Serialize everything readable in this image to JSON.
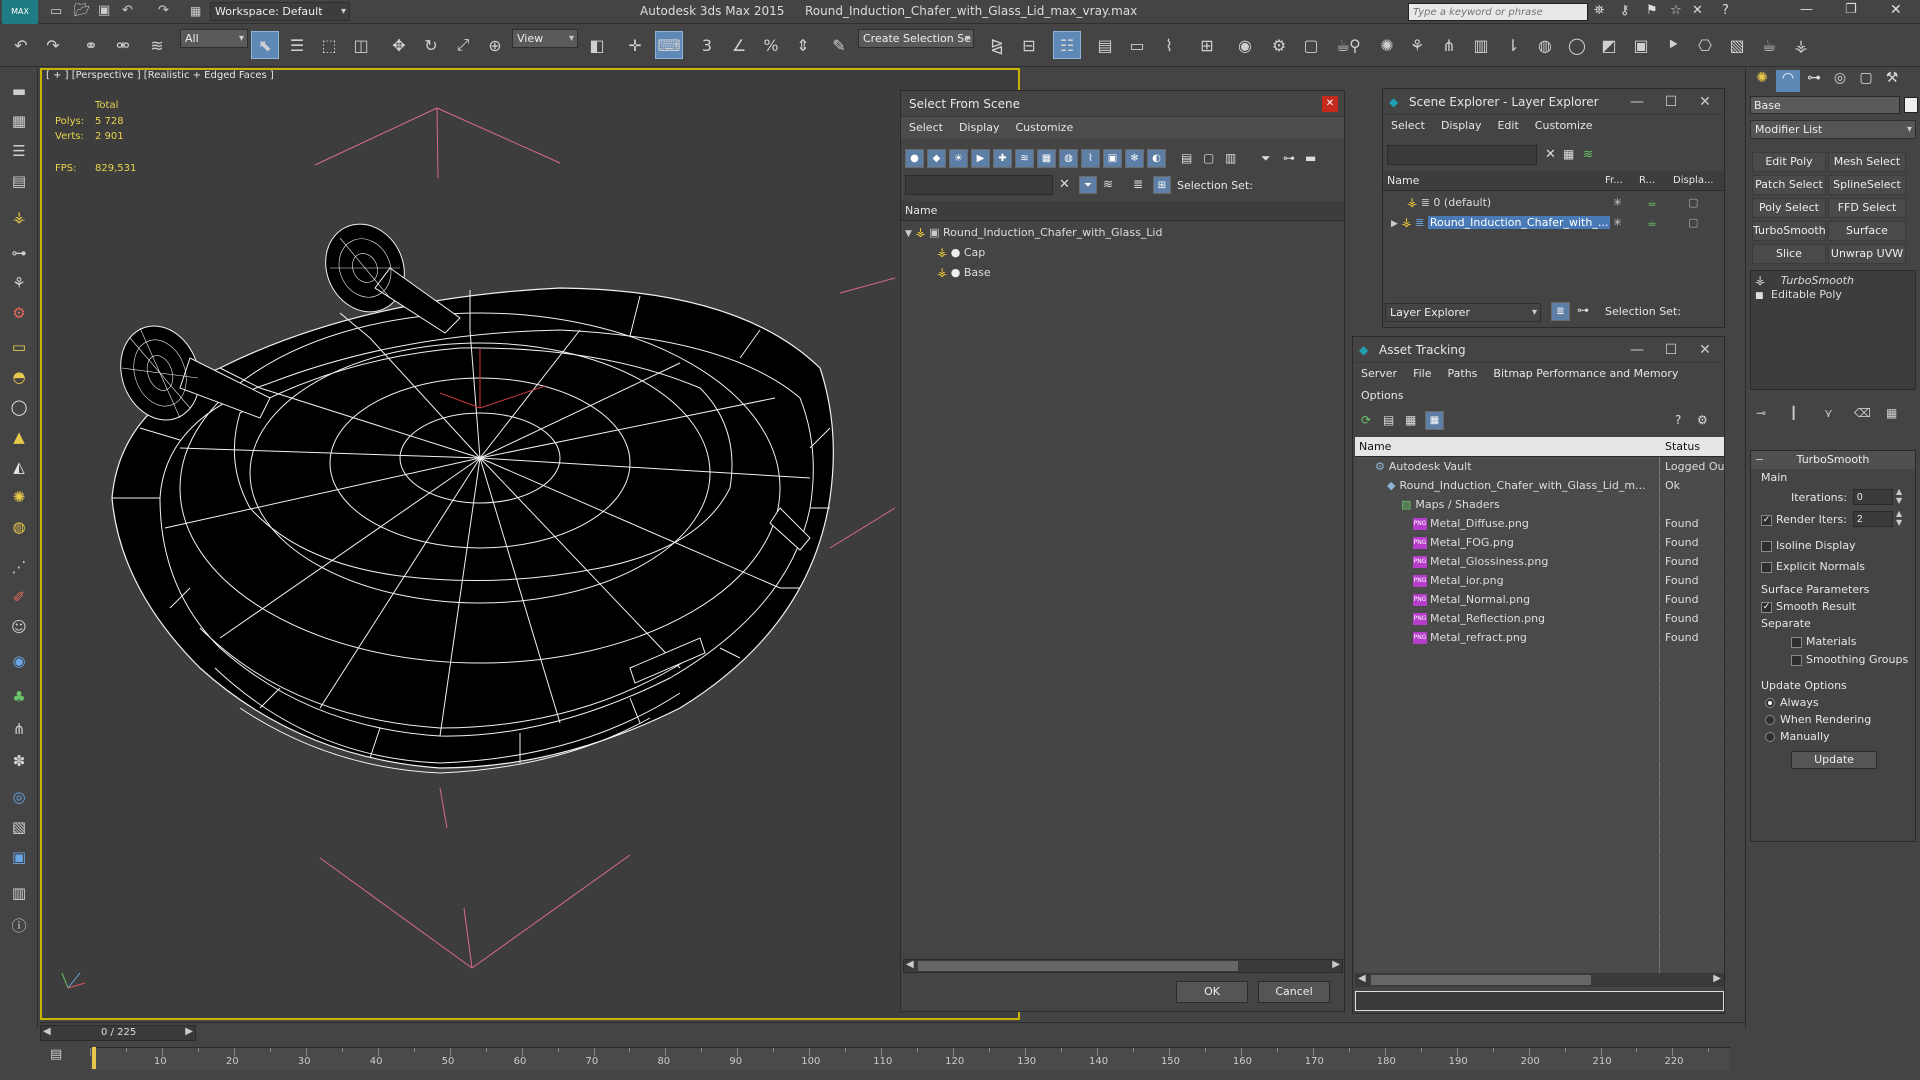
{
  "window": {
    "app_title": "Autodesk 3ds Max  2015",
    "file_title": "Round_Induction_Chafer_with_Glass_Lid_max_vray.max",
    "workspace": "Workspace: Default",
    "search_placeholder": "Type a keyword or phrase"
  },
  "toolbar": {
    "filter_value": "All",
    "refcoord_value": "View",
    "selection_set_value": "Create Selection Se"
  },
  "viewport": {
    "label": "[ + ] [Perspective ] [Realistic + Edged Faces ]",
    "stats_total": "Total",
    "polys_label": "Polys:",
    "polys_value": "5 728",
    "verts_label": "Verts:",
    "verts_value": "2 901",
    "fps_label": "FPS:",
    "fps_value": "829,531"
  },
  "select_from_scene": {
    "title": "Select From Scene",
    "menu": [
      "Select",
      "Display",
      "Customize"
    ],
    "selection_set_label": "Selection Set:",
    "column_name": "Name",
    "tree": {
      "root": "Round_Induction_Chafer_with_Glass_Lid",
      "children": [
        "Cap",
        "Base"
      ]
    },
    "ok_label": "OK",
    "cancel_label": "Cancel"
  },
  "scene_explorer": {
    "title": "Scene Explorer - Layer Explorer",
    "menu": [
      "Select",
      "Display",
      "Edit",
      "Customize"
    ],
    "columns": [
      "Name",
      "Fr...",
      "R...",
      "Displa..."
    ],
    "rows": [
      "0 (default)",
      "Round_Induction_Chafer_with_..."
    ],
    "footer_combo": "Layer Explorer",
    "selection_set_label": "Selection Set:"
  },
  "asset_tracking": {
    "title": "Asset Tracking",
    "menu": [
      "Server",
      "File",
      "Paths",
      "Bitmap Performance and Memory"
    ],
    "menu2": "Options",
    "columns": [
      "Name",
      "Status"
    ],
    "rows": [
      {
        "name": "Autodesk Vault",
        "status": "Logged Ou"
      },
      {
        "name": "Round_Induction_Chafer_with_Glass_Lid_m...",
        "status": "Ok"
      },
      {
        "name": "Maps / Shaders",
        "status": ""
      },
      {
        "name": "Metal_Diffuse.png",
        "status": "Found"
      },
      {
        "name": "Metal_FOG.png",
        "status": "Found"
      },
      {
        "name": "Metal_Glossiness.png",
        "status": "Found"
      },
      {
        "name": "Metal_ior.png",
        "status": "Found"
      },
      {
        "name": "Metal_Normal.png",
        "status": "Found"
      },
      {
        "name": "Metal_Reflection.png",
        "status": "Found"
      },
      {
        "name": "Metal_refract.png",
        "status": "Found"
      }
    ],
    "png_badge": "PNG"
  },
  "command_panel": {
    "object_name": "Base",
    "modifier_list": "Modifier List",
    "buttons": [
      "Edit Poly",
      "Mesh Select",
      "Patch Select",
      "SplineSelect",
      "Poly Select",
      "FFD Select",
      "TurboSmooth",
      "Surface Select",
      "Slice",
      "Unwrap UVW"
    ],
    "stack": [
      "TurboSmooth",
      "Editable Poly"
    ],
    "rollout_title": "TurboSmooth",
    "main_label": "Main",
    "iterations_label": "Iterations:",
    "iterations_value": "0",
    "render_iters_label": "Render Iters:",
    "render_iters_value": "2",
    "isoline_label": "Isoline Display",
    "explicit_normals_label": "Explicit Normals",
    "surface_params_label": "Surface Parameters",
    "smooth_result_label": "Smooth Result",
    "separate_label": "Separate",
    "materials_label": "Materials",
    "smoothing_groups_label": "Smoothing Groups",
    "update_options_label": "Update Options",
    "always_label": "Always",
    "when_rendering_label": "When Rendering",
    "manually_label": "Manually",
    "update_button": "Update"
  },
  "timeline": {
    "frame_counter": "0 / 225",
    "ticks": [
      "10",
      "20",
      "30",
      "40",
      "50",
      "60",
      "70",
      "80",
      "90",
      "100",
      "110",
      "120",
      "130",
      "140",
      "150",
      "160",
      "170",
      "180",
      "190",
      "200",
      "210",
      "220"
    ]
  },
  "colors": {
    "accent": "#5e89b7",
    "viewport_border": "#c8b400",
    "stats_yellow": "#e8d44d",
    "selected_row": "#4a7ab5"
  }
}
